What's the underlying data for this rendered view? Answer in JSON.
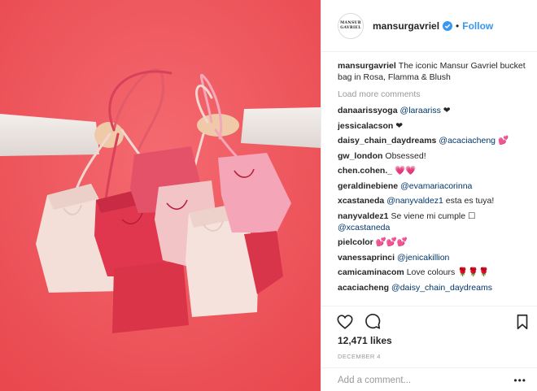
{
  "account": {
    "avatar_lines": [
      "MANSUR",
      "GAVRIEL"
    ],
    "username": "mansurgavriel",
    "separator": "•",
    "follow_label": "Follow"
  },
  "caption": {
    "username": "mansurgavriel",
    "text": "The iconic Mansur Gavriel bucket bag in Rosa, Flamma & Blush"
  },
  "load_more_label": "Load more comments",
  "comments": [
    {
      "user": "danaarissyoga",
      "mention": "@laraariss",
      "text": " ❤"
    },
    {
      "user": "jessicalacson",
      "mention": "",
      "text": "❤"
    },
    {
      "user": "daisy_chain_daydreams",
      "mention": "@acaciacheng",
      "text": " 💕"
    },
    {
      "user": "gw_london",
      "mention": "",
      "text": "Obsessed!"
    },
    {
      "user": "chen.cohen._",
      "mention": "",
      "text": "💗💗"
    },
    {
      "user": "geraldinebiene",
      "mention": "@evamariacorinna",
      "text": ""
    },
    {
      "user": "xcastaneda",
      "mention": "@nanyvaldez1",
      "text": " esta es tuya!"
    },
    {
      "user": "nanyvaldez1",
      "text_before": "Se viene mi cumple ☐",
      "mention": "@xcastaneda",
      "text": ""
    },
    {
      "user": "pielcolor",
      "mention": "",
      "text": "💕💕💕"
    },
    {
      "user": "vanessaprinci",
      "mention": "@jenicakillion",
      "text": ""
    },
    {
      "user": "camicaminacom",
      "mention": "",
      "text": "Love colours 🌹🌹🌹"
    },
    {
      "user": "acaciacheng",
      "mention": "@daisy_chain_daydreams",
      "text": ""
    }
  ],
  "likes": "12,471 likes",
  "date": "DECEMBER 4",
  "add_comment_placeholder": "Add a comment...",
  "more_options": "•••",
  "colors": {
    "background_photo": "#f0575e",
    "link_blue": "#3897f0",
    "mention_blue": "#003569",
    "muted": "#999999",
    "verified": "#3897f0"
  },
  "icons": [
    "verified-badge-icon",
    "heart-icon",
    "comment-icon",
    "bookmark-icon",
    "more-options-icon"
  ]
}
